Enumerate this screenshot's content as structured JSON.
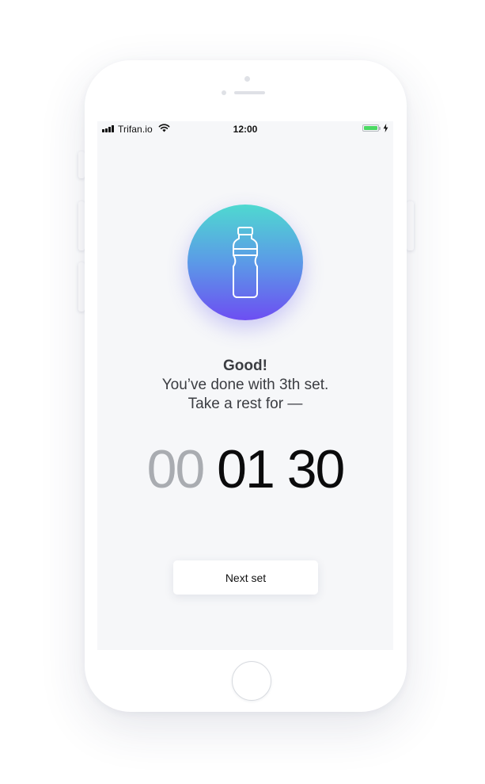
{
  "status_bar": {
    "carrier": "Trifan.io",
    "time": "12:00",
    "signal_icon": "signal-bars-icon",
    "wifi_icon": "wifi-icon",
    "battery_icon": "battery-icon",
    "charging_icon": "charging-bolt-icon",
    "battery_color": "#4cd964"
  },
  "main": {
    "icon": "water-bottle-icon",
    "icon_gradient": [
      "#4fd9d0",
      "#5b9ae7",
      "#6d4ef2"
    ],
    "title": "Good!",
    "line1": "You’ve done with 3th set.",
    "line2": "Take a rest for —",
    "timer": {
      "hours": "00",
      "minutes": "01",
      "seconds": "30"
    },
    "next_button_label": "Next set"
  }
}
